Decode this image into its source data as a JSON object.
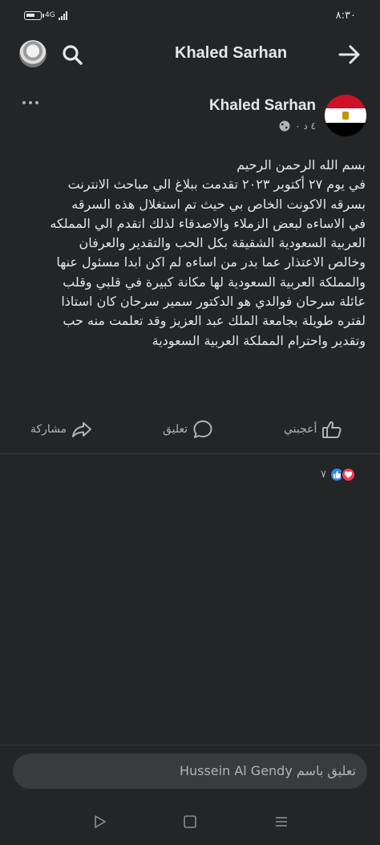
{
  "status_bar": {
    "time": "٨:٣٠",
    "network": "4G"
  },
  "header": {
    "title": "Khaled Sarhan"
  },
  "post": {
    "author": "Khaled Sarhan",
    "time_ago": "٤ د ٠",
    "lines": [
      "بسم الله الرحمن الرحيم",
      "في يوم ٢٧ أكتوبر ٢٠٢٣ تقدمت ببلاغ الي مباحث الانترنت",
      "بسرقه الاكونت الخاص بي  حيث تم استغلال هذه السرقه",
      "في الاساءه لبعض الزملاء والاصدقاء لذلك اتقدم الي المملكه",
      "العربية السعودية الشقيقة بكل الحب والتقدير والعرفان",
      "وخالص الاعتذار عما بدر من اساءه لم اكن ابدا مسئول عنها",
      "والمملكة العربية السعودية لها مكانة كبيرة في قلبي وقلب",
      "عائلة سرحان فوالدي هو الدكتور سمير سرحان كان استاذا",
      "لفتره طويلة  بجامعة الملك عبد العزيز وقد تعلمت منه حب",
      "وتقدير واحترام المملكة العربية السعودية"
    ]
  },
  "actions": {
    "like": "أعجبني",
    "comment": "تعليق",
    "share": "مشاركة"
  },
  "reactions": {
    "count": "٧"
  },
  "comment_box": {
    "placeholder": "تعليق باسم Hussein Al Gendy"
  },
  "colors": {
    "background": "#242526",
    "text": "#e4e6eb",
    "secondary_text": "#b0b3b8",
    "like_blue": "#2d88ff",
    "love_red": "#f33e58"
  },
  "icons": [
    "battery-icon",
    "signal-icon",
    "avatar",
    "search-icon",
    "arrow-right-icon",
    "more-icon",
    "globe-icon",
    "like-icon",
    "comment-icon",
    "share-icon",
    "nav-back-icon",
    "nav-home-icon",
    "nav-recent-icon"
  ]
}
